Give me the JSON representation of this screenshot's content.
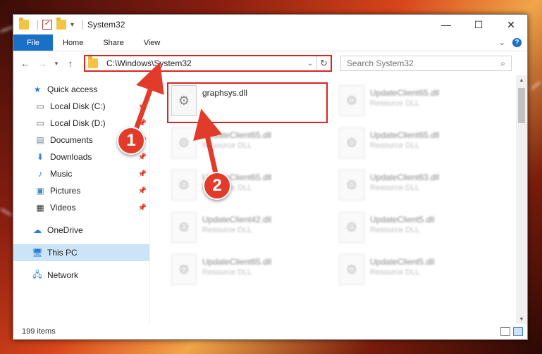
{
  "window": {
    "title": "System32",
    "controls": {
      "minimize": "—",
      "maximize": "☐",
      "close": "✕"
    }
  },
  "ribbon": {
    "tabs": [
      "File",
      "Home",
      "Share",
      "View"
    ],
    "collapse_icon": "chevron-down",
    "help_label": "?"
  },
  "address": {
    "path": "C:\\Windows\\System32",
    "search_placeholder": "Search System32"
  },
  "sidebar": {
    "items": [
      {
        "label": "Quick access",
        "icon": "star-icon"
      },
      {
        "label": "Local Disk (C:)",
        "icon": "drive-icon"
      },
      {
        "label": "Local Disk (D:)",
        "icon": "drive-icon"
      },
      {
        "label": "Documents",
        "icon": "documents-icon"
      },
      {
        "label": "Downloads",
        "icon": "download-icon"
      },
      {
        "label": "Music",
        "icon": "music-icon"
      },
      {
        "label": "Pictures",
        "icon": "pictures-icon"
      },
      {
        "label": "Videos",
        "icon": "videos-icon"
      },
      {
        "label": "OneDrive",
        "icon": "cloud-icon"
      },
      {
        "label": "This PC",
        "icon": "computer-icon"
      },
      {
        "label": "Network",
        "icon": "network-icon"
      }
    ]
  },
  "files": {
    "highlighted": {
      "name": "graphsys.dll"
    },
    "items": [
      {
        "name": "UpdateClient65.dll",
        "type": "Resource DLL"
      },
      {
        "name": "UpdateClient65.dll",
        "type": "Resource DLL"
      },
      {
        "name": "UpdateClient65.dll",
        "type": "Resource DLL"
      },
      {
        "name": "UpdateClient65.dll",
        "type": "Resource DLL"
      },
      {
        "name": "UpdateClient63.dll",
        "type": "Resource DLL"
      },
      {
        "name": "UpdateClient42.dll",
        "type": "Resource DLL"
      },
      {
        "name": "UpdateClient5.dll",
        "type": "Resource DLL"
      },
      {
        "name": "UpdateClient65.dll",
        "type": "Resource DLL"
      },
      {
        "name": "UpdateClient5.dll",
        "type": "Resource DLL"
      }
    ]
  },
  "status": {
    "items_count": "199 items"
  },
  "callouts": {
    "one": "1",
    "two": "2"
  },
  "colors": {
    "accent": "#1a6fc6",
    "highlight": "#dd2222",
    "badge": "#e23b2a"
  }
}
